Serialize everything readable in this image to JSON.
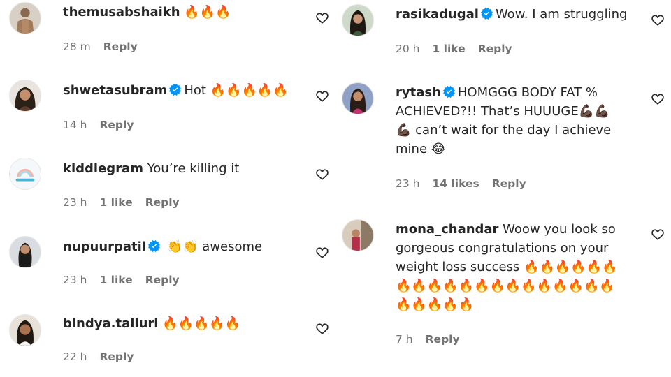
{
  "colors": {
    "text": "#262626",
    "meta": "#737373",
    "verified": "#0095f6",
    "heart_stroke": "#262626"
  },
  "icons": {
    "heart": "heart-outline-icon",
    "verified": "verified-badge-icon",
    "fire": "🔥",
    "clap": "👏",
    "muscle": "💪🏿",
    "laugh": "😂"
  },
  "left": [
    {
      "username": "themusabshaikh",
      "verified": false,
      "text": "",
      "emojis": "🔥🔥🔥",
      "time": "28 m",
      "likes": "",
      "reply": "Reply"
    },
    {
      "username": "shwetasubram",
      "verified": true,
      "text": "Hot",
      "emojis": "🔥🔥🔥🔥🔥",
      "time": "14 h",
      "likes": "",
      "reply": "Reply"
    },
    {
      "username": "kiddiegram",
      "verified": false,
      "text": "You’re killing it",
      "emojis": "",
      "time": "23 h",
      "likes": "1 like",
      "reply": "Reply"
    },
    {
      "username": "nupuurpatil",
      "verified": true,
      "text": "",
      "emojis": "👏👏",
      "text_after": "awesome",
      "time": "23 h",
      "likes": "1 like",
      "reply": "Reply"
    },
    {
      "username": "bindya.talluri",
      "verified": false,
      "text": "",
      "emojis": "🔥🔥🔥🔥🔥",
      "time": "22 h",
      "likes": "",
      "reply": "Reply"
    }
  ],
  "right": [
    {
      "username": "rasikadugal",
      "verified": true,
      "text": "Wow. I am struggling",
      "time": "20 h",
      "likes": "1 like",
      "reply": "Reply"
    },
    {
      "username": "rytash",
      "verified": true,
      "text_1": "HOMGGG BODY FAT % ACHIEVED?!! That’s HUUUGE",
      "emojis_1": "💪🏿💪🏿",
      "emojis_2": "💪🏿",
      "text_2": "can’t wait for the day I achieve mine",
      "emojis_3": "😂",
      "time": "23 h",
      "likes": "14 likes",
      "reply": "Reply"
    },
    {
      "username": "mona_chandar",
      "verified": false,
      "text": "Woow you look so gorgeous congratulations on your weight loss success",
      "emojis": "🔥🔥🔥🔥🔥🔥🔥🔥🔥🔥🔥🔥🔥🔥🔥🔥🔥🔥🔥🔥🔥🔥🔥🔥🔥",
      "time": "7 h",
      "likes": "",
      "reply": "Reply"
    }
  ]
}
